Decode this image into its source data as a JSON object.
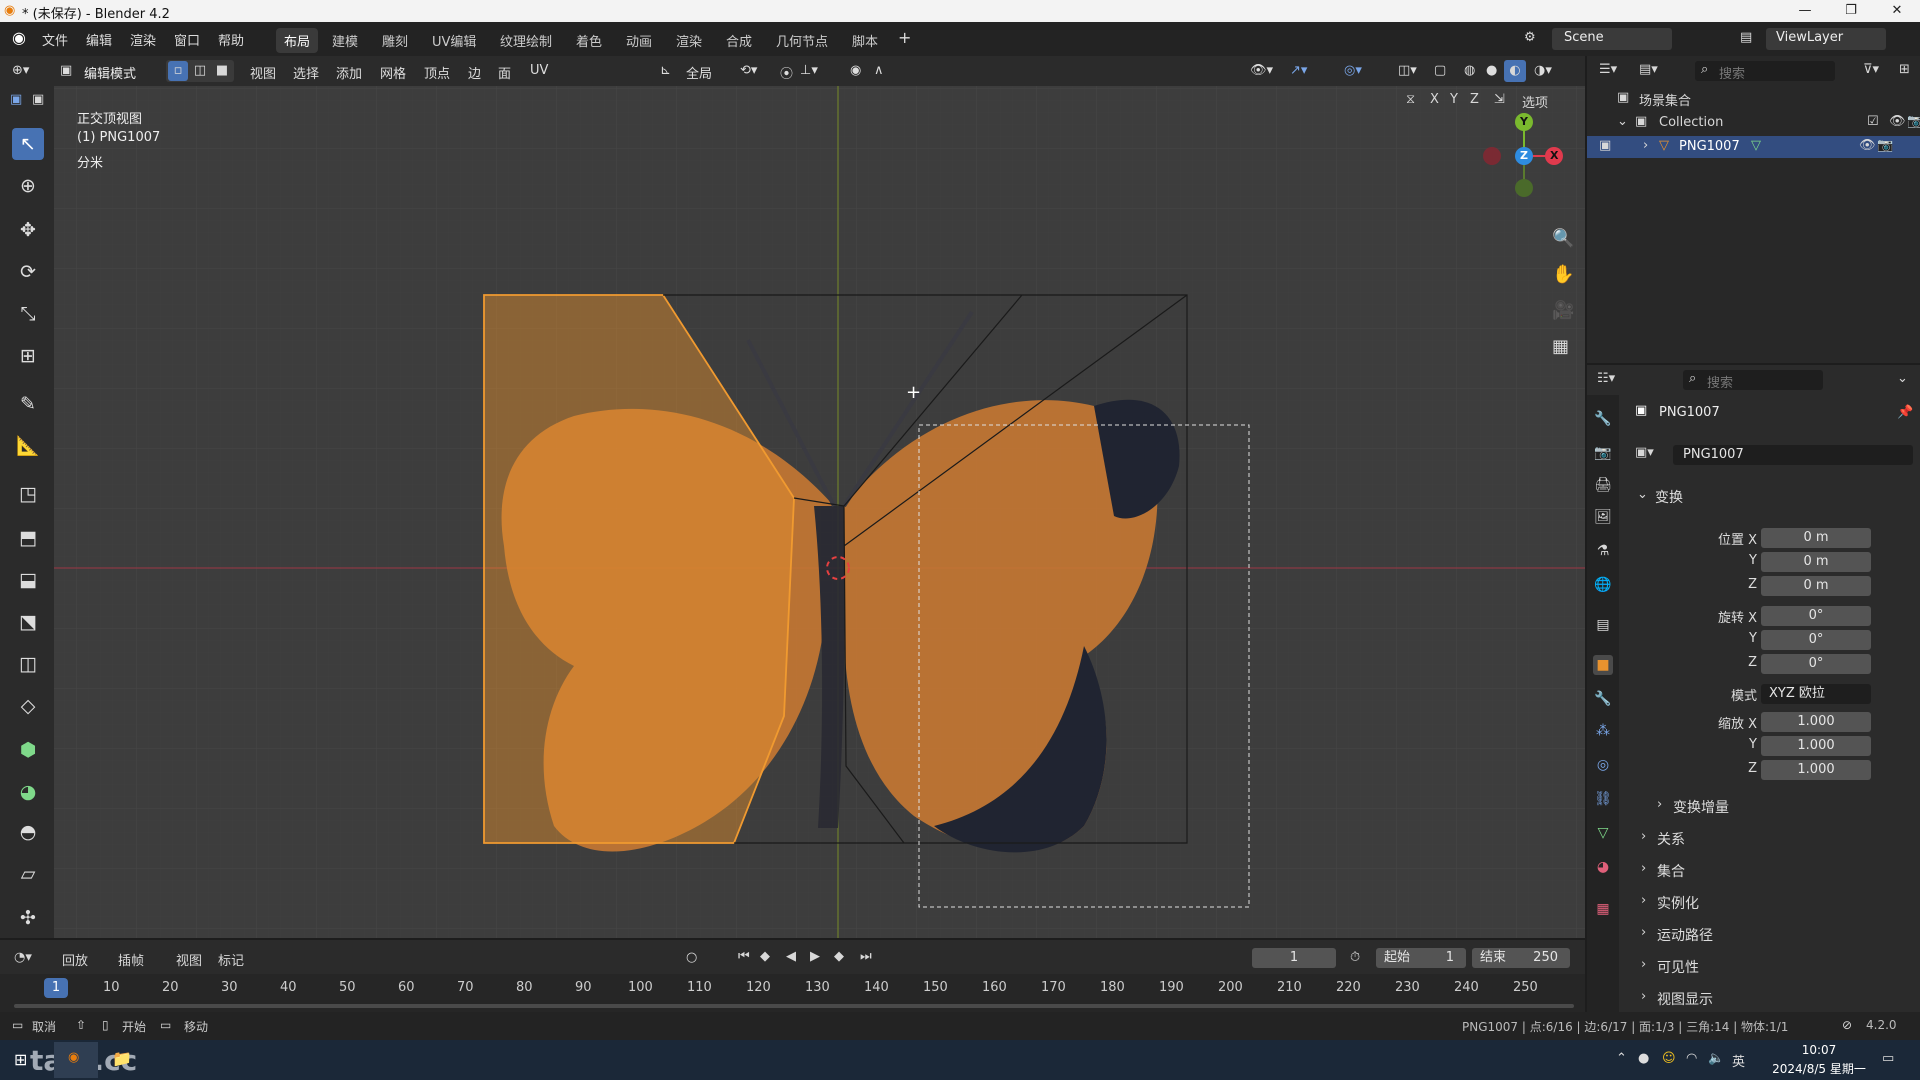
{
  "window": {
    "title": "* (未保存) - Blender 4.2",
    "minimize": "—",
    "maximize": "❐",
    "close": "✕"
  },
  "menu": {
    "file": "文件",
    "edit": "编辑",
    "render": "渲染",
    "window": "窗口",
    "help": "帮助"
  },
  "workspaces": [
    "布局",
    "建模",
    "雕刻",
    "UV编辑",
    "纹理绘制",
    "着色",
    "动画",
    "渲染",
    "合成",
    "几何节点",
    "脚本"
  ],
  "workspace_add": "+",
  "scene": {
    "name": "Scene",
    "view_layer": "ViewLayer"
  },
  "view3d_header": {
    "mode": "编辑模式",
    "items": [
      "视图",
      "选择",
      "添加",
      "网格",
      "顶点",
      "边",
      "面",
      "UV"
    ],
    "orientation": "全局",
    "axes": [
      "X",
      "Y",
      "Z"
    ],
    "options": "选项"
  },
  "viewport_info": {
    "view_name": "正交顶视图",
    "object": "(1) PNG1007",
    "units": "分米"
  },
  "gizmo": {
    "y": "Y",
    "z": "Z",
    "x": "X"
  },
  "colors": {
    "accent": "#4772b3",
    "selection": "#e8922e",
    "x_axis": "#e03a4d",
    "y_axis": "#7ab92e",
    "z_axis": "#2e8ce0"
  },
  "outliner": {
    "search_placeholder": "搜索",
    "scene_collection": "场景集合",
    "collection": "Collection",
    "object": "PNG1007"
  },
  "properties": {
    "search_placeholder": "搜索",
    "object_name": "PNG1007",
    "object_field": "PNG1007",
    "transform_title": "变换",
    "location_label": "位置 X",
    "location": [
      "0 m",
      "0 m",
      "0 m"
    ],
    "rotation_label": "旋转 X",
    "rotation": [
      "0°",
      "0°",
      "0°"
    ],
    "mode_label": "模式",
    "mode_value": "XYZ 欧拉",
    "scale_label": "缩放 X",
    "scale": [
      "1.000",
      "1.000",
      "1.000"
    ],
    "axis_y": "Y",
    "axis_z": "Z",
    "delta_transform": "变换增量",
    "panels": [
      "关系",
      "集合",
      "实例化",
      "运动路径",
      "可见性",
      "视图显示"
    ]
  },
  "timeline": {
    "menus": [
      "回放",
      "插帧",
      "视图",
      "标记"
    ],
    "current_frame": "1",
    "start_label": "起始",
    "start": "1",
    "end_label": "结束",
    "end": "250",
    "ticks": [
      "1",
      "10",
      "20",
      "30",
      "40",
      "50",
      "60",
      "70",
      "80",
      "90",
      "100",
      "110",
      "120",
      "130",
      "140",
      "150",
      "160",
      "170",
      "180",
      "190",
      "200",
      "210",
      "220",
      "230",
      "240",
      "250"
    ]
  },
  "statusbar": {
    "cancel": "取消",
    "start": "开始",
    "move": "移动",
    "stats": "PNG1007 | 点:6/16 | 边:6/17 | 面:1/3 | 三角:14 | 物体:1/1",
    "version": "4.2.0"
  },
  "taskbar": {
    "watermark": "tafe.cc",
    "ime": "英",
    "time": "10:07",
    "date": "2024/8/5 星期一"
  }
}
